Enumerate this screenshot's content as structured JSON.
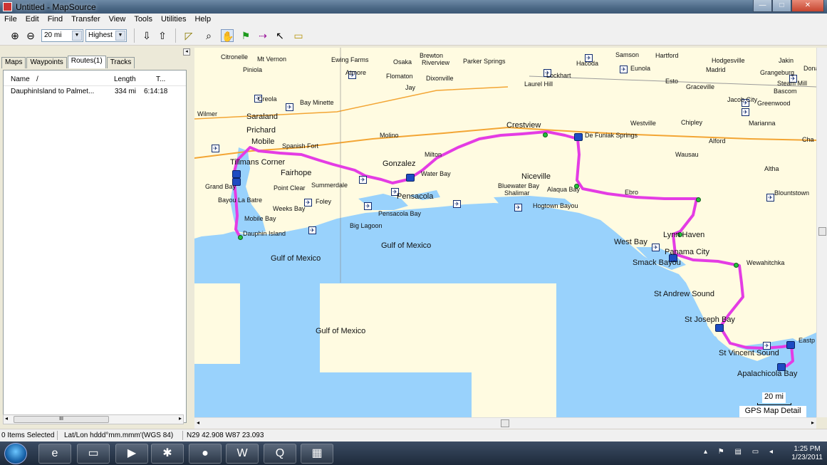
{
  "window": {
    "title": "Untitled - MapSource"
  },
  "menu": [
    "File",
    "Edit",
    "Find",
    "Transfer",
    "View",
    "Tools",
    "Utilities",
    "Help"
  ],
  "toolbar": {
    "zoom_in_icon": "zoom-in-icon",
    "zoom_out_icon": "zoom-out-icon",
    "scale_value": "20 mi",
    "detail_value": "Highest"
  },
  "left_panel": {
    "tabs": [
      "Maps",
      "Waypoints",
      "Routes(1)",
      "Tracks"
    ],
    "active_tab": "Routes(1)",
    "columns": {
      "name": "Name",
      "sort": "/",
      "length": "Length",
      "time": "T..."
    },
    "routes": [
      {
        "name": "DauphinIsland to Palmet...",
        "length": "334 mi",
        "time": "6:14:18"
      }
    ],
    "scroll_thumb": "III"
  },
  "map": {
    "labels": {
      "citronelle": "Citronelle",
      "mt_vernon": "Mt Vernon",
      "ewing_farms": "Ewing Farms",
      "osaka": "Osaka",
      "brewton": "Brewton",
      "riverview": "Riverview",
      "parker_springs": "Parker Springs",
      "samson": "Samson",
      "hacoda": "Hacoda",
      "eunola": "Eunola",
      "hartford": "Hartford",
      "hodgesville": "Hodgesville",
      "jakin": "Jakin",
      "donals": "Donals",
      "madrid": "Madrid",
      "grangeburg": "Grangeburg",
      "steam_mill": "Steam Mill",
      "piniola": "Piniola",
      "atmore": "Atmore",
      "flomaton": "Flomaton",
      "dixonville": "Dixonville",
      "lockhart": "Lockhart",
      "esto": "Esto",
      "graceville": "Graceville",
      "jay": "Jay",
      "laurel_hill": "Laurel Hill",
      "bascom": "Bascom",
      "jacob_city": "Jacob City",
      "greenwood": "Greenwood",
      "creola": "Creola",
      "bay_minette": "Bay Minette",
      "marianna": "Marianna",
      "wilmer": "Wilmer",
      "saraland": "Saraland",
      "westville": "Westville",
      "chipley": "Chipley",
      "prichard": "Prichard",
      "crestview": "Crestview",
      "molino": "Molino",
      "de_funiak": "De Funiak Springs",
      "mobile": "Mobile",
      "spanish_fort": "Spanish Fort",
      "alford": "Alford",
      "cha": "Cha",
      "tillmans_corner": "Tillmans Corner",
      "milton": "Milton",
      "gonzalez": "Gonzalez",
      "wausau": "Wausau",
      "fairhope": "Fairhope",
      "water_bay": "Water Bay",
      "altha": "Altha",
      "niceville": "Niceville",
      "grand_bay": "Grand Bay",
      "point_clear": "Point Clear",
      "summerdale": "Summerdale",
      "bayou_la_batre": "Bayou La Batre",
      "foley": "Foley",
      "pensacola": "Pensacola",
      "bluewater_bay": "Bluewater Bay",
      "shalimar": "Shalimar",
      "alaqua_bay": "Alaqua Bay",
      "ebro": "Ebro",
      "blountstown": "Blountstown",
      "weeks_bay": "Weeks Bay",
      "pensacola_bay": "Pensacola Bay",
      "hogtown_bayou": "Hogtown Bayou",
      "mobile_bay": "Mobile Bay",
      "big_lagoon": "Big Lagoon",
      "dauphin_island": "Dauphin Island",
      "lynn_haven": "Lynn Haven",
      "gulf1": "Gulf of Mexico",
      "gulf2": "Gulf of Mexico",
      "gulf3": "Gulf of Mexico",
      "west_bay": "West Bay",
      "panama_city": "Panama City",
      "smack_bayou": "Smack Bayou",
      "wewahitchka": "Wewahitchka",
      "st_andrew_sound": "St Andrew Sound",
      "st_joseph_bay": "St Joseph Bay",
      "st_vincent_sound": "St Vincent Sound",
      "eastpoint": "Eastp",
      "apalachicola_bay": "Apalachicola Bay"
    },
    "scale_label": "20 mi",
    "detail_label": "GPS Map Detail",
    "colors": {
      "water": "#99d2fc",
      "land": "#fffbe1",
      "route": "#e43ce4",
      "waypoint": "#23c13a",
      "road": "#f3a534"
    }
  },
  "status": {
    "items_selected": "0 Items Selected",
    "format": "Lat/Lon hddd°mm.mmm'(WGS 84)",
    "position": "N29 42.908 W87 23.093"
  },
  "taskbar": {
    "apps": [
      "ie-icon",
      "explorer-icon",
      "media-player-icon",
      "network-icon",
      "firefox-icon",
      "word-icon",
      "q-icon",
      "mapsource-icon"
    ],
    "time": "1:25 PM",
    "date": "1/23/2011"
  }
}
